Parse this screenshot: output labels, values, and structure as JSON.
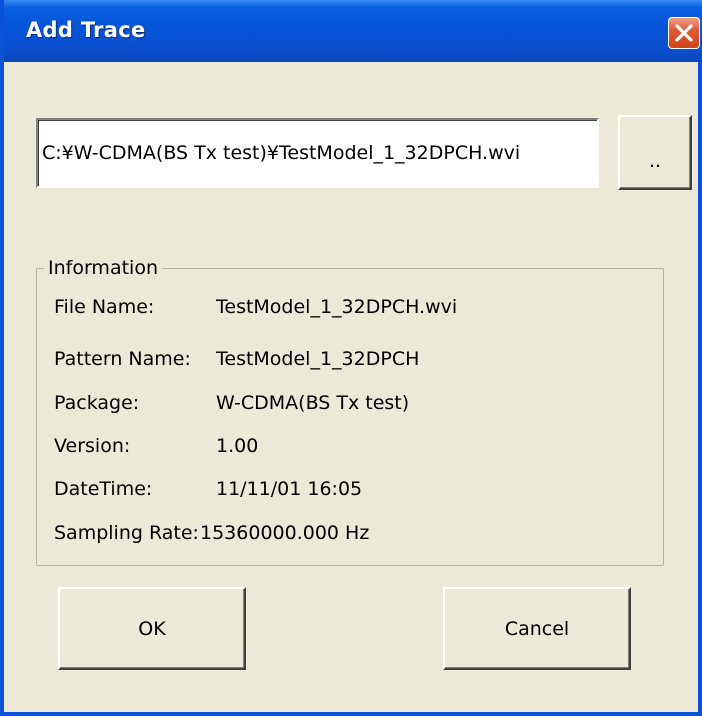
{
  "window": {
    "title": "Add Trace"
  },
  "file": {
    "path": "C:¥W-CDMA(BS Tx test)¥TestModel_1_32DPCH.wvi"
  },
  "browse_button": {
    "label": ".."
  },
  "information": {
    "legend": "Information",
    "file_name_label": "File Name:",
    "file_name_value": "TestModel_1_32DPCH.wvi",
    "pattern_name_label": "Pattern Name:",
    "pattern_name_value": "TestModel_1_32DPCH",
    "package_label": "Package:",
    "package_value": "W-CDMA(BS Tx test)",
    "version_label": "Version:",
    "version_value": "1.00",
    "datetime_label": "DateTime:",
    "datetime_value": "11/11/01 16:05",
    "sampling_rate_label": "Sampling Rate:",
    "sampling_rate_value": "15360000.000 Hz"
  },
  "buttons": {
    "ok": "OK",
    "cancel": "Cancel"
  },
  "colors": {
    "titlebar": "#0553d8",
    "close": "#d04418",
    "dialog_bg": "#ece9d8"
  }
}
